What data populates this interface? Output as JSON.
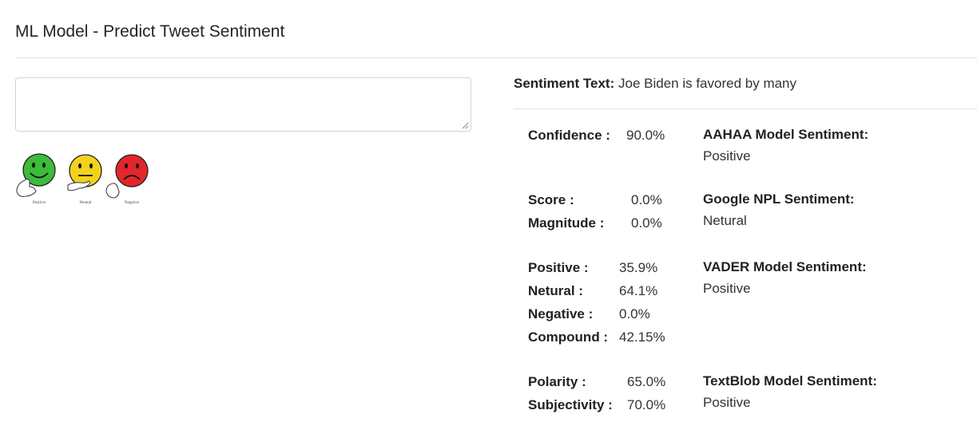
{
  "header": {
    "title": "ML Model - Predict Tweet Sentiment"
  },
  "input": {
    "value": ""
  },
  "emoji_legend": {
    "labels": [
      "Positive",
      "Neutral",
      "Negative"
    ],
    "colors": [
      "#3dbb3a",
      "#f2d21c",
      "#e3262b"
    ]
  },
  "sentiment_text": {
    "label": "Sentiment Text:",
    "value": "Joe Biden is favored by many"
  },
  "aahaa": {
    "confidence_label": "Confidence :",
    "confidence": "90.0%",
    "model_label": "AAHAA Model Sentiment:",
    "sentiment": "Positive"
  },
  "google": {
    "score_label": "Score :",
    "score": "0.0%",
    "magnitude_label": "Magnitude :",
    "magnitude": "0.0%",
    "model_label": "Google NPL Sentiment:",
    "sentiment": "Netural"
  },
  "vader": {
    "positive_label": "Positive :",
    "positive": "35.9%",
    "neutral_label": "Netural :",
    "neutral": "64.1%",
    "negative_label": "Negative :",
    "negative": "0.0%",
    "compound_label": "Compound :",
    "compound": "42.15%",
    "model_label": "VADER Model Sentiment:",
    "sentiment": "Positive"
  },
  "textblob": {
    "polarity_label": "Polarity :",
    "polarity": "65.0%",
    "subjectivity_label": "Subjectivity :",
    "subjectivity": "70.0%",
    "model_label": "TextBlob Model Sentiment:",
    "sentiment": "Positive"
  }
}
